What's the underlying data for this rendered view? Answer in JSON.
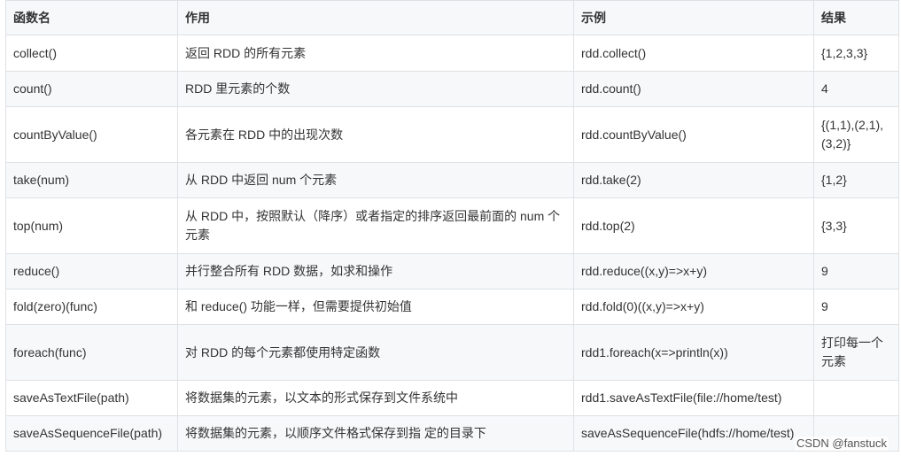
{
  "headers": [
    "函数名",
    "作用",
    "示例",
    "结果"
  ],
  "rows": [
    {
      "name": "collect()",
      "purpose": "返回 RDD 的所有元素",
      "example": "rdd.collect()",
      "result": "{1,2,3,3}"
    },
    {
      "name": "count()",
      "purpose": "RDD 里元素的个数",
      "example": "rdd.count()",
      "result": "4"
    },
    {
      "name": "countByValue()",
      "purpose": "各元素在 RDD 中的出现次数",
      "example": "rdd.countByValue()",
      "result": "{(1,1),(2,1),(3,2)}"
    },
    {
      "name": "take(num)",
      "purpose": "从 RDD 中返回 num 个元素",
      "example": "rdd.take(2)",
      "result": "{1,2}"
    },
    {
      "name": "top(num)",
      "purpose": "从 RDD 中，按照默认（降序）或者指定的排序返回最前面的 num 个元素",
      "example": "rdd.top(2)",
      "result": "{3,3}"
    },
    {
      "name": "reduce()",
      "purpose": "并行整合所有 RDD 数据，如求和操作",
      "example": "rdd.reduce((x,y)=>x+y)",
      "result": "9"
    },
    {
      "name": "fold(zero)(func)",
      "purpose": "和 reduce() 功能一样，但需要提供初始值",
      "example": "rdd.fold(0)((x,y)=>x+y)",
      "result": "9"
    },
    {
      "name": "foreach(func)",
      "purpose": "对 RDD 的每个元素都使用特定函数",
      "example": "rdd1.foreach(x=>println(x))",
      "result": "打印每一个元素"
    },
    {
      "name": "saveAsTextFile(path)",
      "purpose": "将数据集的元素，以文本的形式保存到文件系统中",
      "example": "rdd1.saveAsTextFile(file://home/test)",
      "result": ""
    },
    {
      "name": "saveAsSequenceFile(path)",
      "purpose": "将数据集的元素，以顺序文件格式保存到指 定的目录下",
      "example": "saveAsSequenceFile(hdfs://home/test)",
      "result": ""
    }
  ],
  "watermark": "CSDN @fanstuck"
}
